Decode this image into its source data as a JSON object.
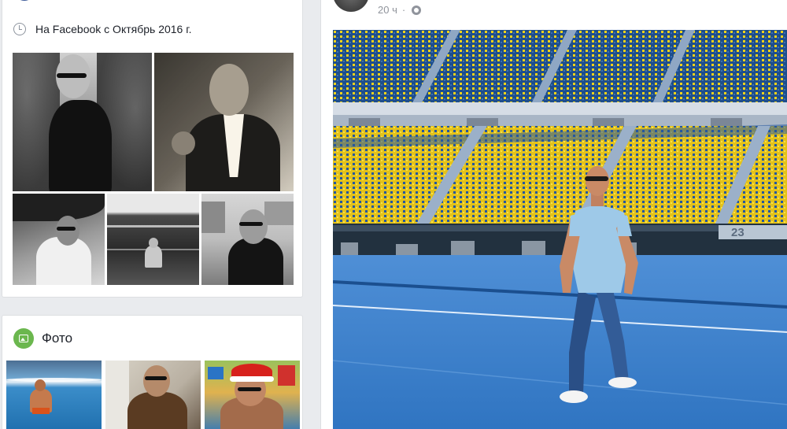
{
  "intro": {
    "joined_text": "На Facebook с Октябрь 2016 г.",
    "clock_icon": "clock-icon"
  },
  "photos": {
    "title": "Фото",
    "icon": "photos-icon"
  },
  "post": {
    "time": "20 ч",
    "separator": "·",
    "privacy_icon": "globe-icon",
    "stadium_sign": "23"
  },
  "colors": {
    "page_bg": "#e9ebee",
    "card_border": "#dddfe2",
    "fb_blue": "#3b5998",
    "photos_green": "#6bb74e",
    "stadium_blue": "#1e4e8c",
    "seat_yellow": "#f2d31b",
    "track_blue": "#2f7cc8"
  }
}
